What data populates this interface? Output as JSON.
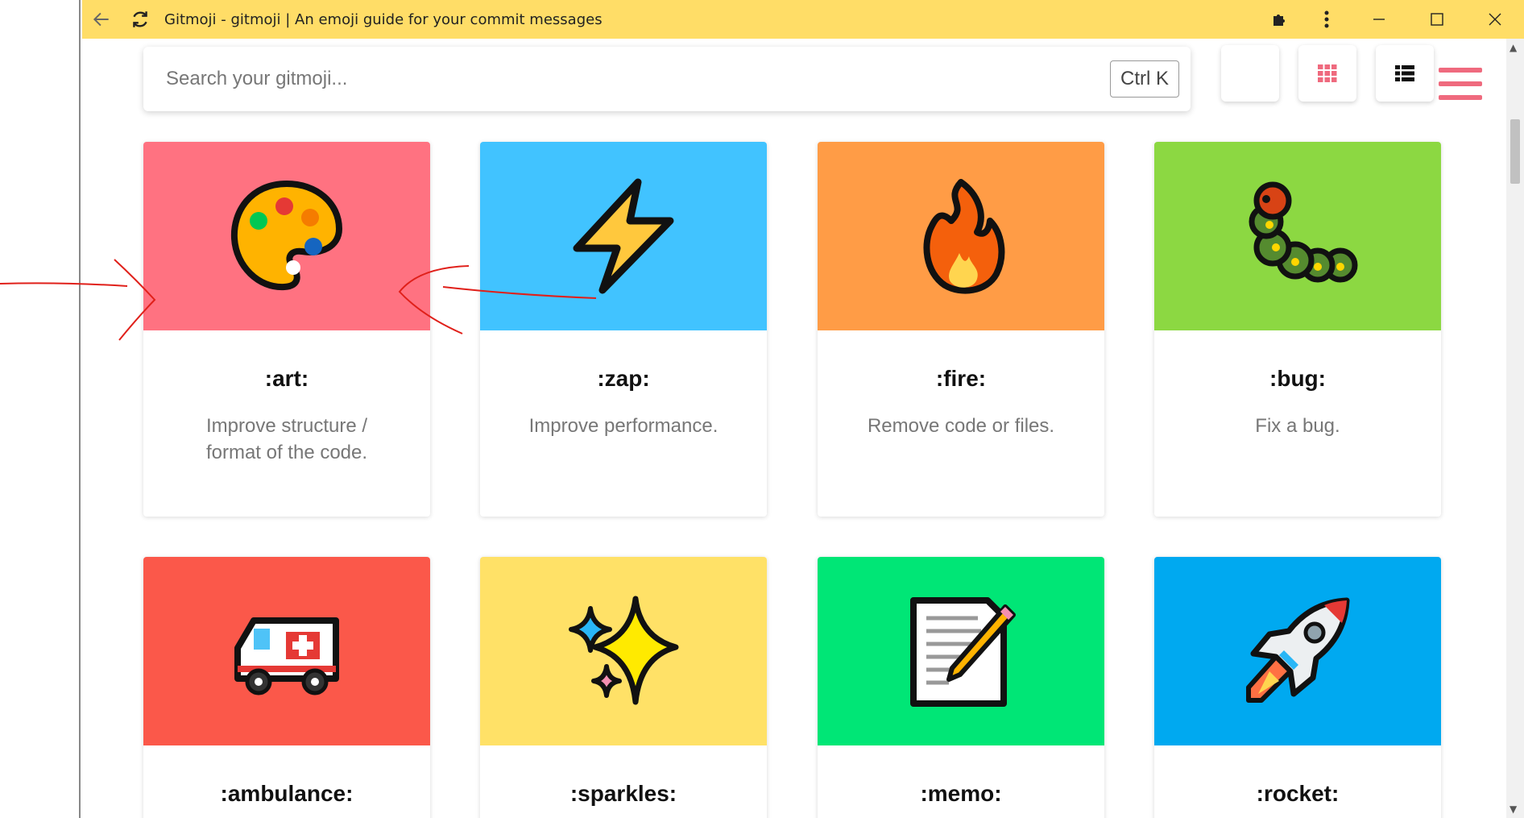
{
  "browser": {
    "title": "Gitmoji - gitmoji | An emoji guide for your commit messages"
  },
  "search": {
    "placeholder": "Search your gitmoji...",
    "shortcut": "Ctrl K"
  },
  "toolbar_icons": [
    "moon-icon",
    "grid-icon",
    "list-icon",
    "menu-icon"
  ],
  "accent_color": "#ef6a7e",
  "gitmojis": [
    {
      "code": ":art:",
      "description": "Improve structure / format of the code.",
      "color": "#ff7281",
      "icon": "palette-icon"
    },
    {
      "code": ":zap:",
      "description": "Improve performance.",
      "color": "#41c3ff",
      "icon": "high-voltage-icon"
    },
    {
      "code": ":fire:",
      "description": "Remove code or files.",
      "color": "#ff9c46",
      "icon": "fire-icon"
    },
    {
      "code": ":bug:",
      "description": "Fix a bug.",
      "color": "#8cd842",
      "icon": "bug-icon"
    },
    {
      "code": ":ambulance:",
      "description": "",
      "color": "#fb584a",
      "icon": "ambulance-icon"
    },
    {
      "code": ":sparkles:",
      "description": "",
      "color": "#ffe167",
      "icon": "sparkles-icon"
    },
    {
      "code": ":memo:",
      "description": "",
      "color": "#00e676",
      "icon": "memo-icon"
    },
    {
      "code": ":rocket:",
      "description": "",
      "color": "#00a9f0",
      "icon": "rocket-icon"
    }
  ]
}
